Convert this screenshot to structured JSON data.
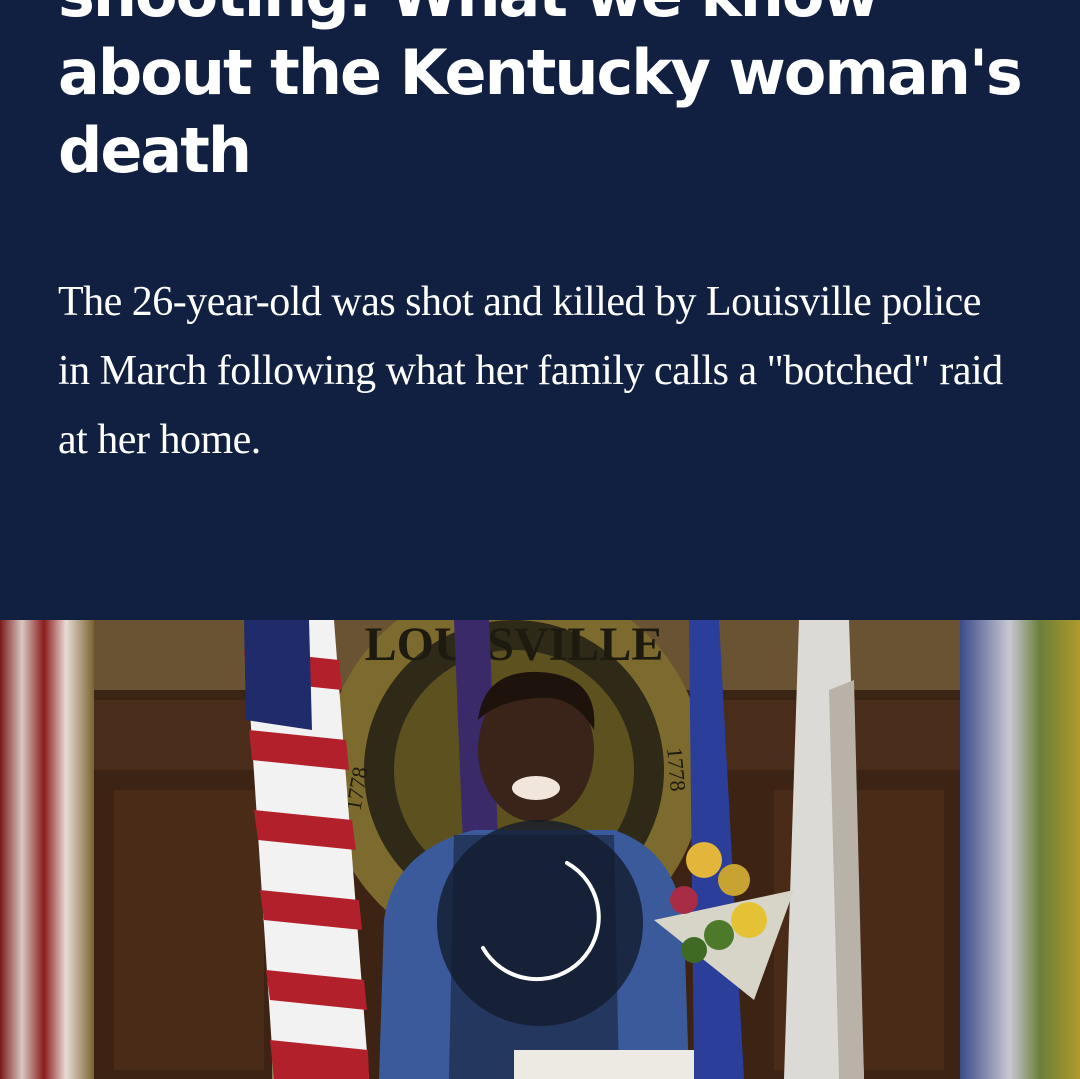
{
  "article": {
    "headline": "shooting: What we know about the Kentucky woman's death",
    "dek": "The 26-year-old was shot and killed by Louisville police in March following what her family calls a \"botched\" raid at her home."
  },
  "media": {
    "state": "loading",
    "seal_text": "LOUISVILLE",
    "seal_year": "1778"
  },
  "colors": {
    "header_bg": "#112040",
    "text": "#ffffff"
  }
}
